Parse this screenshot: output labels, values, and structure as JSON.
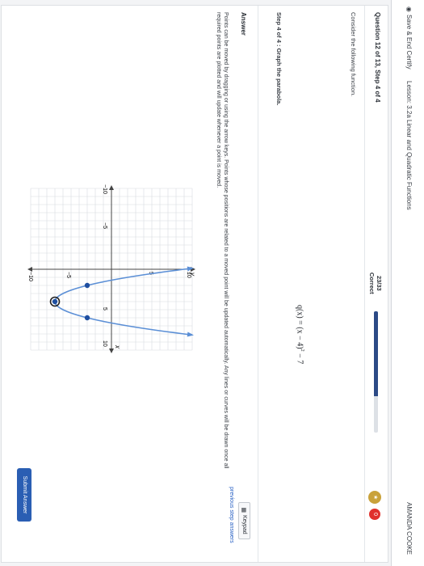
{
  "header": {
    "save_label": "Save & End Certify",
    "lesson": "Lesson: 3.2a Linear and Quadratic Functions",
    "user": "AMANDA COOKE"
  },
  "question": {
    "title": "Question 12 of 13, Step 4 of 4",
    "score": "23/33",
    "score_status": "Correct",
    "progress_fraction": 0.7,
    "badge_count": "0",
    "prompt": "Consider the following function.",
    "function": "q(x) = (x − 4)² − 7",
    "function_base": "q(x) = (x − 4)",
    "function_exp": "2",
    "function_tail": " − 7",
    "step": "Step 4 of 4 :  Graph the parabola."
  },
  "answer": {
    "label": "Answer",
    "keypad": "Keypad",
    "previous": "previous step answers",
    "instructions": "Points can be moved by dragging or using the arrow keys. Points whose positions are related to a moved point will be updated automatically. Any lines or curves will be drawn once all required points are plotted and will update whenever a point is moved.",
    "submit": "Submit Answer"
  },
  "graph": {
    "x_label": "x",
    "y_label": "y",
    "tick_labels": {
      "xneg10": "−10",
      "xneg5": "−5",
      "x5": "5",
      "x10": "10",
      "y10": "10",
      "y5": "5",
      "yneg5": "−5",
      "yneg10": "−10"
    },
    "vertex": [
      4,
      -7
    ],
    "points": [
      [
        2,
        -3
      ],
      [
        4,
        -7
      ],
      [
        6,
        -3
      ]
    ],
    "x_range": [
      -10,
      10
    ],
    "y_range": [
      -10,
      10
    ],
    "colors": {
      "curve": "#5b8fd6",
      "point": "#1f4fa0",
      "vertex_ring": "#222222"
    }
  }
}
